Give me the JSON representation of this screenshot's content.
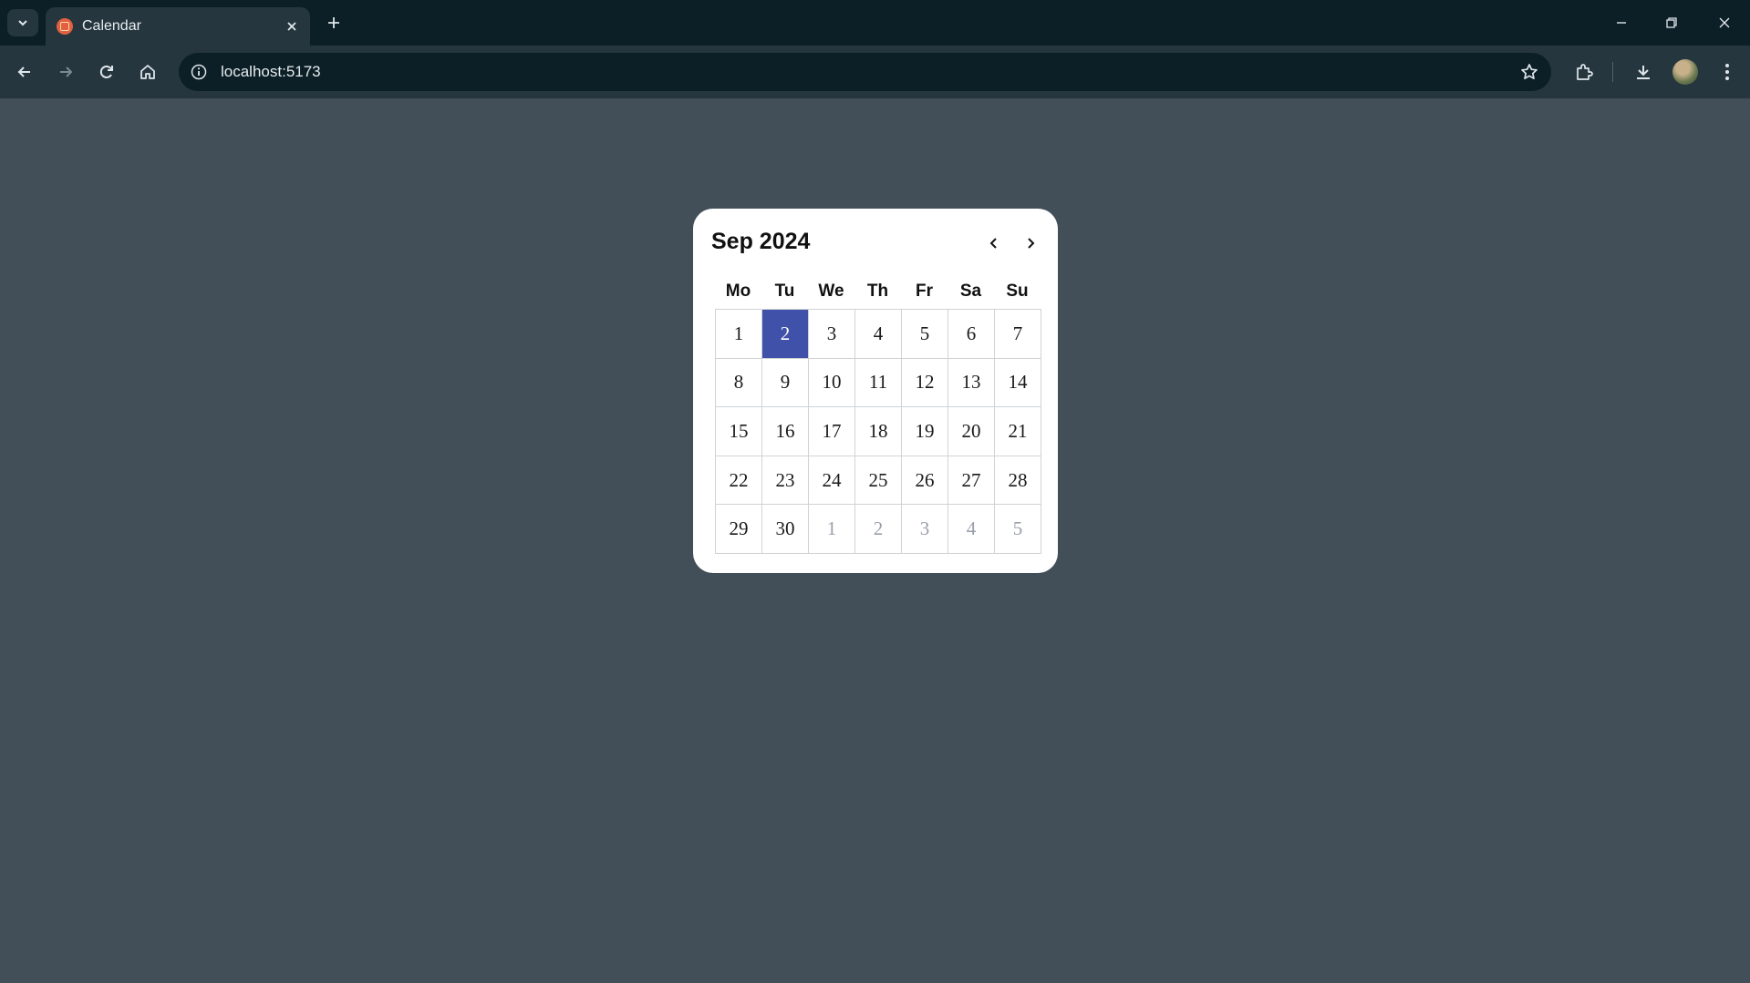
{
  "browser": {
    "tab_title": "Calendar",
    "url": "localhost:5173"
  },
  "calendar": {
    "month_label": "Sep 2024",
    "weekdays": [
      "Mo",
      "Tu",
      "We",
      "Th",
      "Fr",
      "Sa",
      "Su"
    ],
    "selected_day": "2",
    "days": [
      {
        "label": "1",
        "in_month": true
      },
      {
        "label": "2",
        "in_month": true
      },
      {
        "label": "3",
        "in_month": true
      },
      {
        "label": "4",
        "in_month": true
      },
      {
        "label": "5",
        "in_month": true
      },
      {
        "label": "6",
        "in_month": true
      },
      {
        "label": "7",
        "in_month": true
      },
      {
        "label": "8",
        "in_month": true
      },
      {
        "label": "9",
        "in_month": true
      },
      {
        "label": "10",
        "in_month": true
      },
      {
        "label": "11",
        "in_month": true
      },
      {
        "label": "12",
        "in_month": true
      },
      {
        "label": "13",
        "in_month": true
      },
      {
        "label": "14",
        "in_month": true
      },
      {
        "label": "15",
        "in_month": true
      },
      {
        "label": "16",
        "in_month": true
      },
      {
        "label": "17",
        "in_month": true
      },
      {
        "label": "18",
        "in_month": true
      },
      {
        "label": "19",
        "in_month": true
      },
      {
        "label": "20",
        "in_month": true
      },
      {
        "label": "21",
        "in_month": true
      },
      {
        "label": "22",
        "in_month": true
      },
      {
        "label": "23",
        "in_month": true
      },
      {
        "label": "24",
        "in_month": true
      },
      {
        "label": "25",
        "in_month": true
      },
      {
        "label": "26",
        "in_month": true
      },
      {
        "label": "27",
        "in_month": true
      },
      {
        "label": "28",
        "in_month": true
      },
      {
        "label": "29",
        "in_month": true
      },
      {
        "label": "30",
        "in_month": true
      },
      {
        "label": "1",
        "in_month": false
      },
      {
        "label": "2",
        "in_month": false
      },
      {
        "label": "3",
        "in_month": false
      },
      {
        "label": "4",
        "in_month": false
      },
      {
        "label": "5",
        "in_month": false
      }
    ]
  },
  "colors": {
    "page_background": "#434f58",
    "selected_day": "#3f51a8",
    "other_month_text": "#9a9ea8"
  }
}
